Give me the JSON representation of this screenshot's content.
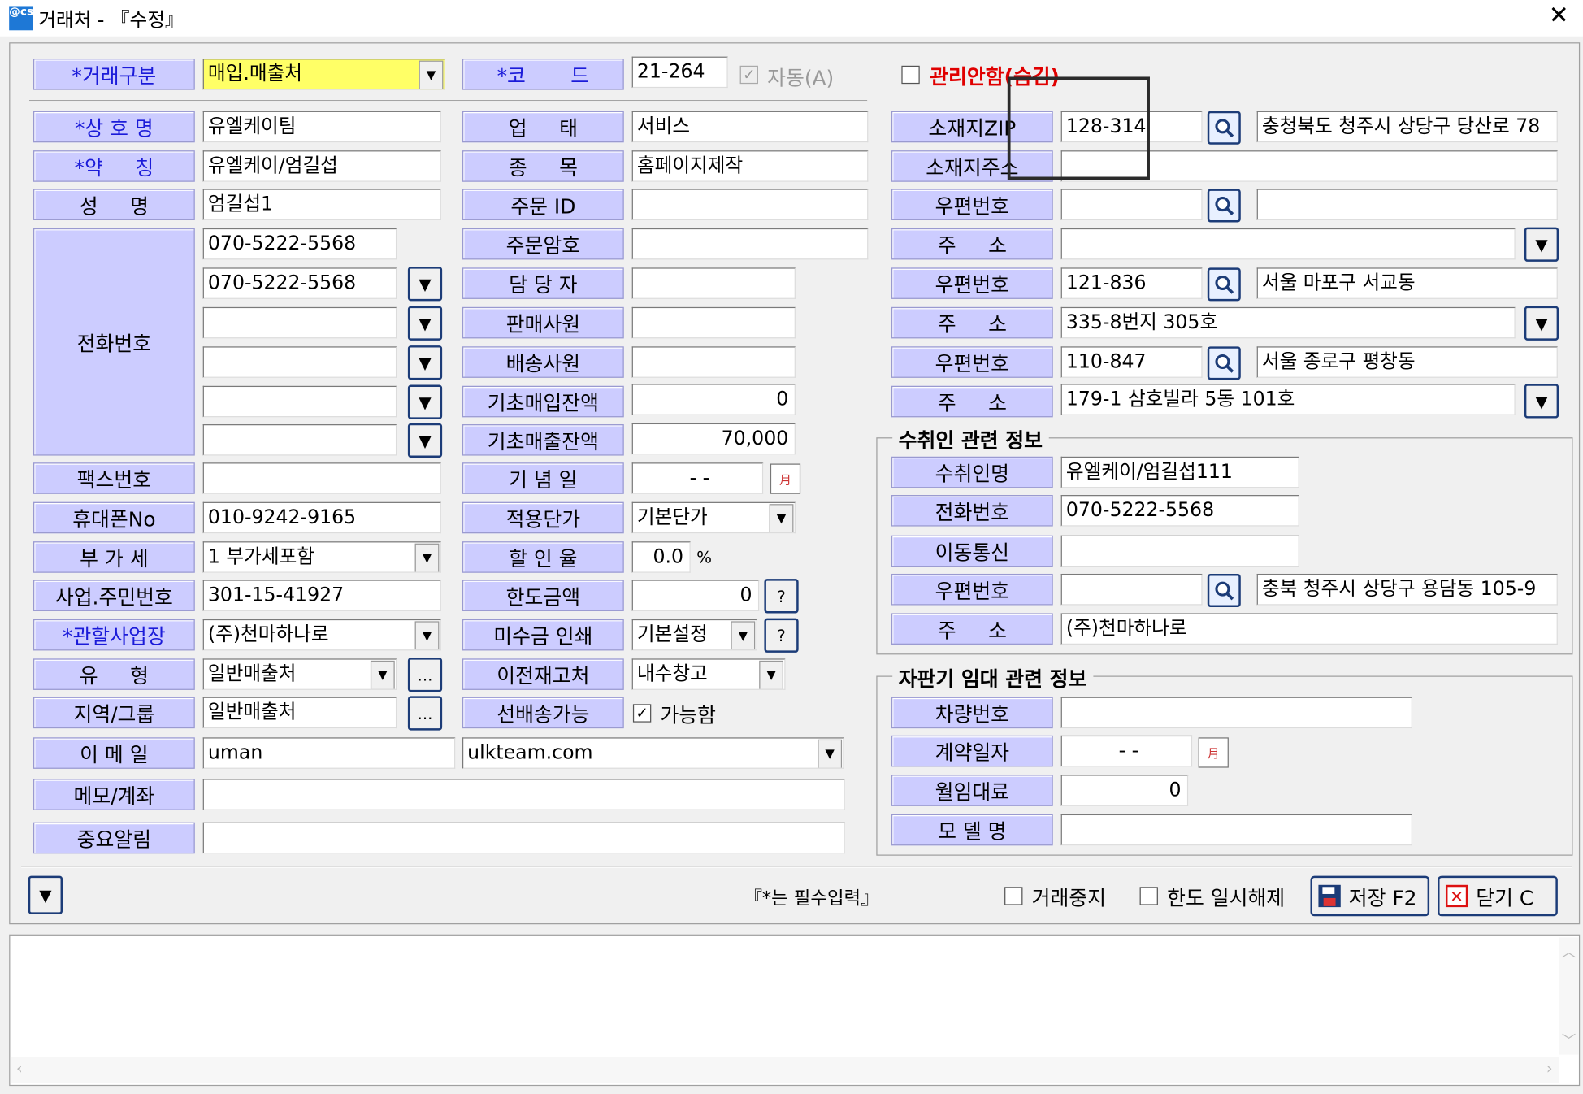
{
  "window": {
    "title": "거래처 - 『수정』",
    "app_icon_text": "@cs",
    "close_label": "✕"
  },
  "top": {
    "trade_type_label": "*거래구분",
    "trade_type_value": "매입.매출처",
    "code_label": "*코       드",
    "code_value": "21-264",
    "auto_label": "자동(A)",
    "mgmt_label": "관리안함(숨김)"
  },
  "left": {
    "company_label": "*상 호 명",
    "company_value": "유엘케이팀",
    "short_label": "*약     칭",
    "short_value": "유엘케이/엄길섭",
    "name_label": "성     명",
    "name_value": "엄길섭1",
    "phone_label": "전화번호",
    "phones": [
      "070-5222-5568",
      "070-5222-5568",
      "",
      "",
      "",
      ""
    ],
    "fax_label": "팩스번호",
    "fax_value": "",
    "mobile_label": "휴대폰No",
    "mobile_value": "010-9242-9165",
    "vat_label": "부 가 세",
    "vat_value": "1 부가세포함",
    "bizno_label": "사업.주민번호",
    "bizno_value": "301-15-41927",
    "branch_label": "*관할사업장",
    "branch_value": "(주)천마하나로",
    "type_label": "유     형",
    "type_value": "일반매출처",
    "region_label": "지역/그룹",
    "region_value": "일반매출처",
    "email_label": "이 메 일",
    "email_user": "uman",
    "email_domain": "ulkteam.com",
    "memo_label": "메모/계좌",
    "memo_value": "",
    "notice_label": "중요알림",
    "notice_value": ""
  },
  "middle": {
    "biz_cond_label": "업     태",
    "biz_cond_value": "서비스",
    "biz_item_label": "종     목",
    "biz_item_value": "홈페이지제작",
    "order_id_label": "주문 ID",
    "order_id_value": "",
    "order_pw_label": "주문암호",
    "order_pw_value": "",
    "manager_label": "담 당 자",
    "manager_value": "",
    "sales_label": "판매사원",
    "sales_value": "",
    "delivery_label": "배송사원",
    "delivery_value": "",
    "buy_balance_label": "기초매입잔액",
    "buy_balance_value": "0",
    "sell_balance_label": "기초매출잔액",
    "sell_balance_value": "70,000",
    "anniv_label": "기 념 일",
    "anniv_value": "-   -",
    "unit_price_label": "적용단가",
    "unit_price_value": "기본단가",
    "discount_label": "할 인 율",
    "discount_value": "0.0",
    "discount_unit": "%",
    "limit_label": "한도금액",
    "limit_value": "0",
    "receivable_label": "미수금 인쇄",
    "receivable_value": "기본설정",
    "prev_stock_label": "이전재고처",
    "prev_stock_value": "내수창고",
    "prepay_label": "선배송가능",
    "prepay_value": "가능함"
  },
  "right": {
    "loc_zip_label": "소재지ZIP",
    "loc_zip_value": "128-314",
    "loc_zip_addr": "충청북도 청주시 상당구 당산로 78",
    "loc_addr_label": "소재지주소",
    "loc_addr_value": "",
    "zip1_label": "우편번호",
    "zip1_value": "",
    "zip1_addr": "",
    "addr1_label": "주     소",
    "addr1_value": "",
    "zip2_label": "우편번호",
    "zip2_value": "121-836",
    "zip2_addr": "서울 마포구 서교동",
    "addr2_label": "주     소",
    "addr2_value": "335-8번지 305호",
    "zip3_label": "우편번호",
    "zip3_value": "110-847",
    "zip3_addr": "서울 종로구 평창동",
    "addr3_label": "주     소",
    "addr3_value": "179-1 삼호빌라 5동 101호"
  },
  "recipient": {
    "title": "수취인 관련 정보",
    "name_label": "수취인명",
    "name_value": "유엘케이/엄길섭111",
    "phone_label": "전화번호",
    "phone_value": "070-5222-5568",
    "mobile_label": "이동통신",
    "mobile_value": "",
    "zip_label": "우편번호",
    "zip_value": "",
    "zip_addr": "충북 청주시 상당구 용담동 105-9",
    "addr_label": "주     소",
    "addr_value": "(주)천마하나로"
  },
  "vending": {
    "title": "자판기 임대 관련 정보",
    "car_label": "차량번호",
    "car_value": "",
    "contract_label": "계약일자",
    "contract_value": "-   -",
    "rent_label": "월임대료",
    "rent_value": "0",
    "model_label": "모 델 명",
    "model_value": ""
  },
  "footer": {
    "required_note": "『*는 필수입력』",
    "stop_trade_label": "거래중지",
    "limit_release_label": "한도 일시해제",
    "save_label": "저장 F2",
    "close_label": "닫기 C"
  }
}
